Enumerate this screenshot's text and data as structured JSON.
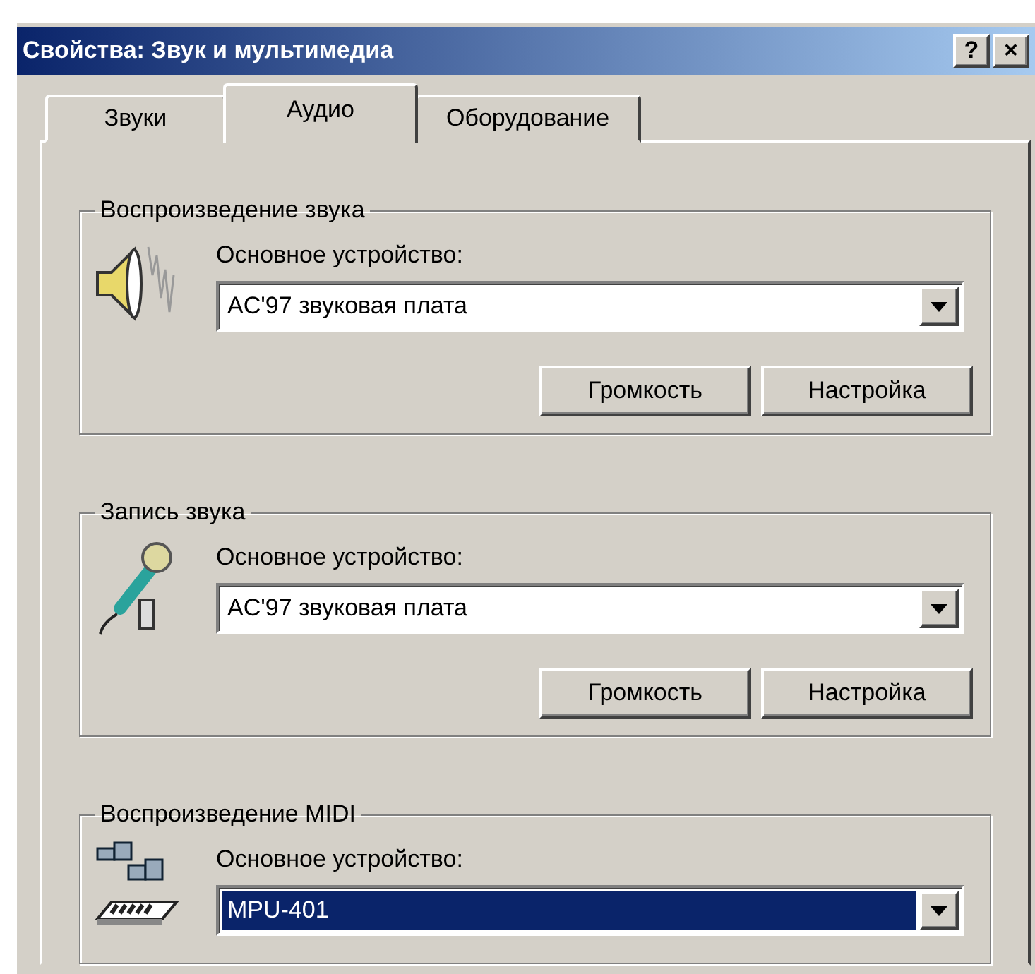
{
  "window": {
    "title": "Свойства: Звук и мультимедиа",
    "title_buttons": [
      "?",
      "×"
    ]
  },
  "tabs": [
    {
      "label": "Звуки",
      "selected": false
    },
    {
      "label": "Аудио",
      "selected": true
    },
    {
      "label": "Оборудование",
      "selected": false
    }
  ],
  "groups": [
    {
      "title": "Воспроизведение звука",
      "kind": "speaker",
      "label": "Основное устройство:",
      "value": "AC'97 звуковая плата",
      "focused": false,
      "buttons": [
        "Громкость",
        "Настройка"
      ]
    },
    {
      "title": "Запись звука",
      "kind": "microphone",
      "label": "Основное устройство:",
      "value": "AC'97 звуковая плата",
      "focused": false,
      "buttons": [
        "Громкость",
        "Настройка"
      ]
    },
    {
      "title": "Воспроизведение MIDI",
      "kind": "midi",
      "label": "Основное устройство:",
      "value": "MPU-401",
      "focused": true
    }
  ]
}
